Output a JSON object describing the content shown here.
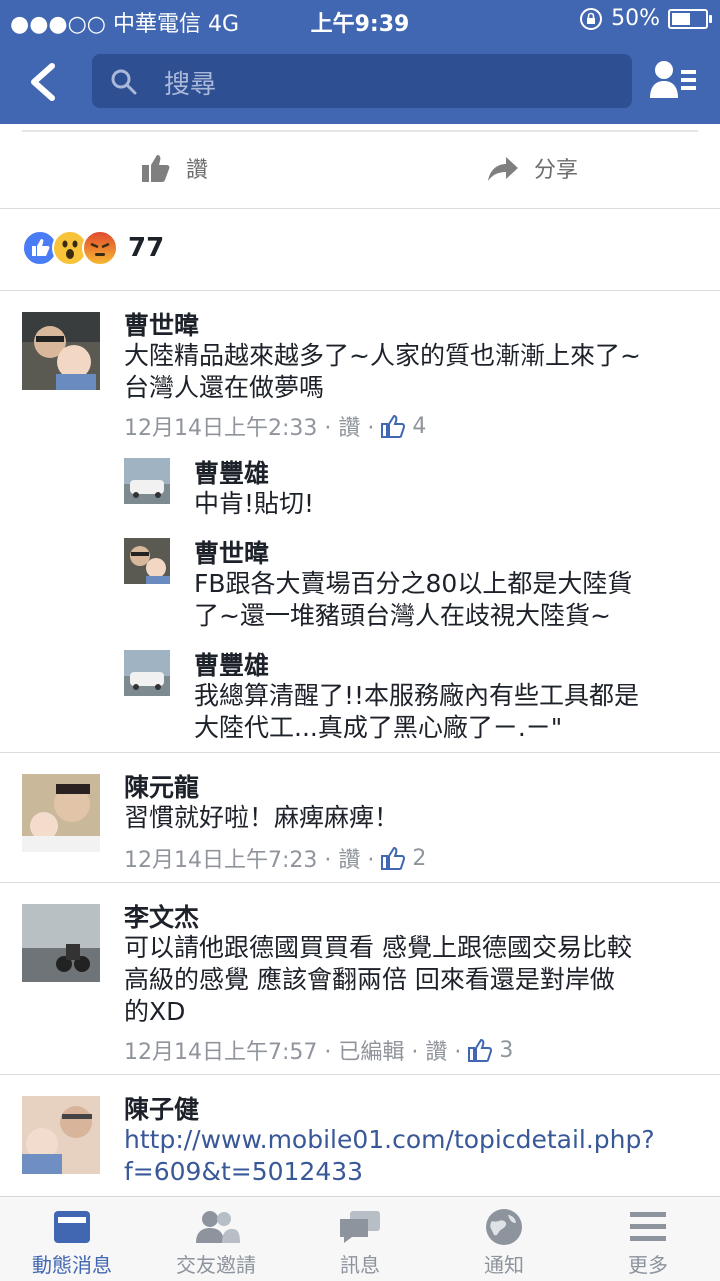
{
  "status": {
    "carrier": "●●●○○ 中華電信  4G",
    "time": "上午9:39",
    "battery": "50%",
    "battery_level": 0.5
  },
  "search": {
    "placeholder": "搜尋"
  },
  "post_actions": {
    "like": "讚",
    "share": "分享"
  },
  "reactions": {
    "count": "77",
    "types": [
      "like-icon",
      "wow-icon",
      "angry-icon"
    ]
  },
  "comments": [
    {
      "name": "曹世暐",
      "lines": [
        "大陸精品越來越多了~人家的質也漸漸上來了~",
        "台灣人還在做夢嗎"
      ],
      "time": "12月14日上午2:33 · 讚 ·",
      "likes": "4",
      "replies": [
        {
          "name": "曹豐雄",
          "lines": [
            "中肯!貼切!"
          ]
        },
        {
          "name": "曹世暐",
          "lines": [
            "FB跟各大賣場百分之80以上都是大陸貨",
            "了~還一堆豬頭台灣人在歧視大陸貨~"
          ]
        },
        {
          "name": "曹豐雄",
          "lines": [
            "我總算清醒了!!本服務廠內有些工具都是",
            "大陸代工...真成了黑心廠了ㄧ.ㄧ\""
          ]
        }
      ]
    },
    {
      "name": "陳元龍",
      "lines": [
        "習慣就好啦！麻痺麻痺！"
      ],
      "time": "12月14日上午7:23 · 讚 ·",
      "likes": "2"
    },
    {
      "name": "李文杰",
      "lines": [
        "可以請他跟德國買買看  感覺上跟德國交易比較",
        "高級的感覺  應該會翻兩倍  回來看還是對岸做",
        "的XD"
      ],
      "time": "12月14日上午7:57 · 已編輯 · 讚 ·",
      "likes": "3"
    },
    {
      "name": "陳子健",
      "lines": [
        "http://www.mobile01.com/topicdetail.php?",
        "f=609&t=5012433"
      ]
    }
  ],
  "tabs": [
    {
      "label": "動態消息",
      "icon": "news-feed-icon"
    },
    {
      "label": "交友邀請",
      "icon": "friend-requests-icon"
    },
    {
      "label": "訊息",
      "icon": "messages-icon"
    },
    {
      "label": "通知",
      "icon": "notifications-globe-icon"
    },
    {
      "label": "更多",
      "icon": "more-menu-icon"
    }
  ],
  "colors": {
    "brand": "#4267b2",
    "link": "#385898",
    "meta": "#90949c"
  }
}
